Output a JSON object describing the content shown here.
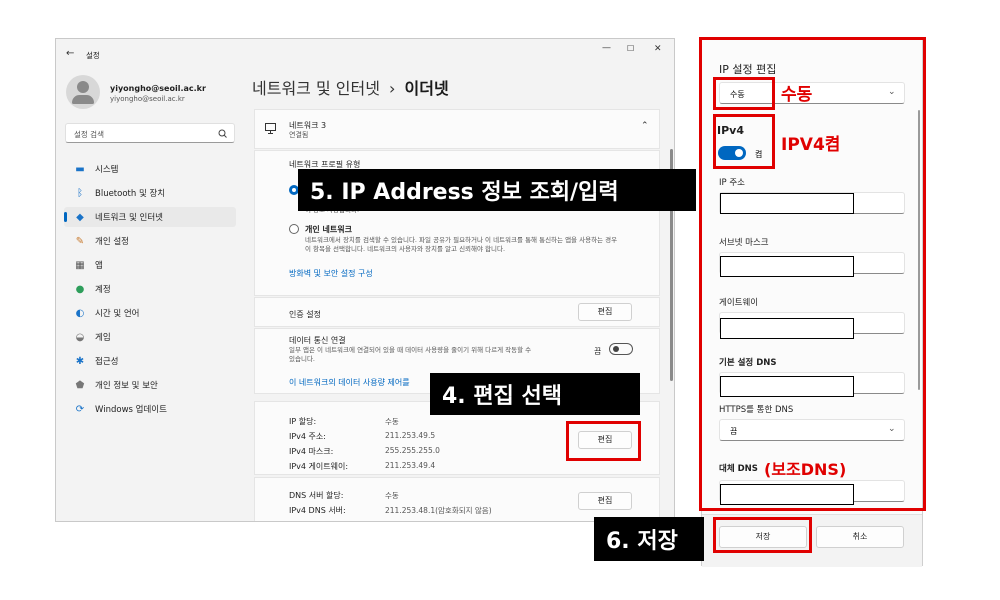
{
  "window": {
    "back_icon": "back-arrow-icon",
    "title": "설정",
    "controls": [
      "—",
      "☐",
      "✕"
    ]
  },
  "profile": {
    "name": "yiyongho@seoil.ac.kr",
    "email": "yiyongho@seoil.ac.kr"
  },
  "search": {
    "placeholder": "설정 검색"
  },
  "nav": [
    {
      "label": "시스템",
      "icon": "monitor-icon",
      "color": "#1a73c8"
    },
    {
      "label": "Bluetooth 및 장치",
      "icon": "bluetooth-icon",
      "color": "#1a73c8"
    },
    {
      "label": "네트워크 및 인터넷",
      "icon": "wifi-icon",
      "color": "#1a73c8",
      "selected": true
    },
    {
      "label": "개인 설정",
      "icon": "brush-icon",
      "color": "#c7792c"
    },
    {
      "label": "앱",
      "icon": "apps-icon",
      "color": "#555555"
    },
    {
      "label": "계정",
      "icon": "person-icon",
      "color": "#2e9e5b"
    },
    {
      "label": "시간 및 언어",
      "icon": "globe-clock-icon",
      "color": "#1a73c8"
    },
    {
      "label": "게임",
      "icon": "gamepad-icon",
      "color": "#777777"
    },
    {
      "label": "접근성",
      "icon": "accessibility-icon",
      "color": "#1a73c8"
    },
    {
      "label": "개인 정보 및 보안",
      "icon": "shield-icon",
      "color": "#777777"
    },
    {
      "label": "Windows 업데이트",
      "icon": "update-icon",
      "color": "#1a73c8"
    }
  ],
  "breadcrumb": {
    "parent": "네트워크 및 인터넷",
    "sep": "›",
    "current": "이더넷"
  },
  "network": {
    "name": "네트워크 3",
    "status": "연결됨"
  },
  "profile_type": {
    "heading": "네트워크 프로필 유형",
    "public_desc": "이 장소 사용합니다.",
    "private_label": "개인 네트워크",
    "private_desc": "네트워크에서 장치를 검색할 수 있습니다. 파일 공유가 필요하거나 이 네트워크를 통해 통신하는 앱을 사용하는 경우 이 항목을 선택합니다. 네트워크의 사용자와 장치를 알고 신뢰해야 합니다.",
    "firewall_link": "방화벽 및 보안 설정 구성"
  },
  "auth": {
    "label": "인증 설정",
    "button": "편집"
  },
  "metered": {
    "label": "데이터 통신 연결",
    "desc": "일부 앱은 이 네트워크에 연결되어 있을 때 데이터 사용량을 줄이기 위해 다르게 작동할 수 있습니다.",
    "toggle_text": "끔",
    "link": "이 네트워크의 데이터 사용량 제어를"
  },
  "ip": {
    "rows": [
      {
        "label": "IP 할당:",
        "value": "수동"
      },
      {
        "label": "IPv4 주소:",
        "value": "211.253.49.5"
      },
      {
        "label": "IPv4 마스크:",
        "value": "255.255.255.0"
      },
      {
        "label": "IPv4 게이트웨이:",
        "value": "211.253.49.4"
      }
    ],
    "button": "편집"
  },
  "dns": {
    "rows": [
      {
        "label": "DNS 서버 할당:",
        "value": "수동"
      },
      {
        "label": "IPv4 DNS 서버:",
        "value": "211.253.48.1(암호화되지 않음)"
      }
    ],
    "button": "편집"
  },
  "annotations": {
    "step5": "5. IP Address 정보 조회/입력",
    "step4": "4. 편집 선택",
    "step6": "6. 저장",
    "manual_note": "수동",
    "ipv4_note": "IPV4켬",
    "alt_dns_note": "(보조DNS)"
  },
  "dialog": {
    "title": "IP 설정 편집",
    "mode": "수동",
    "ipv4_label": "IPv4",
    "ipv4_toggle": "켬",
    "fields": [
      "IP 주소",
      "서브넷 마스크",
      "게이트웨이",
      "기본 설정 DNS"
    ],
    "https_label": "HTTPS를 통한 DNS",
    "https_value": "끔",
    "alt_dns_label": "대체 DNS",
    "save": "저장",
    "cancel": "취소"
  }
}
